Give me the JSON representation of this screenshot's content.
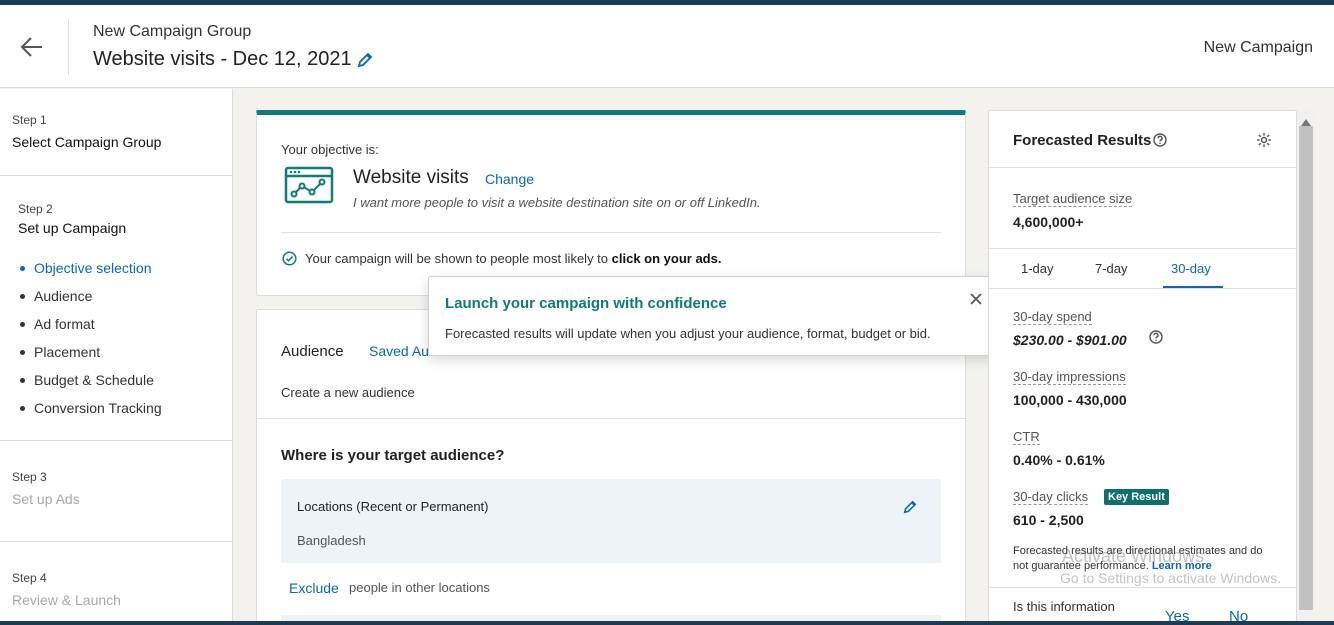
{
  "header": {
    "subtitle": "New Campaign Group",
    "title": "Website visits - Dec 12, 2021",
    "right_label": "New Campaign"
  },
  "sidebar": {
    "steps": [
      {
        "num": "Step 1",
        "title": "Select Campaign Group"
      },
      {
        "num": "Step 2",
        "title": "Set up Campaign"
      },
      {
        "num": "Step 3",
        "title": "Set up Ads"
      },
      {
        "num": "Step 4",
        "title": "Review & Launch"
      }
    ],
    "substeps": [
      {
        "label": "Objective selection"
      },
      {
        "label": "Audience"
      },
      {
        "label": "Ad format"
      },
      {
        "label": "Placement"
      },
      {
        "label": "Budget & Schedule"
      },
      {
        "label": "Conversion Tracking"
      }
    ]
  },
  "objective": {
    "label": "Your objective is:",
    "name": "Website visits",
    "change": "Change",
    "description": "I want more people to visit a website destination site on or off LinkedIn.",
    "note_prefix": "Your campaign will be shown to people most likely to ",
    "note_bold": "click on your ads."
  },
  "audience": {
    "title": "Audience",
    "saved": "Saved Au",
    "create": "Create a new audience",
    "where": "Where is your target audience?",
    "locations_title": "Locations (Recent or Permanent)",
    "locations_value": "Bangladesh",
    "exclude": "Exclude",
    "exclude_text": "people in other locations"
  },
  "popover": {
    "title": "Launch your campaign with confidence",
    "text": "Forecasted results will update when you adjust your audience, format, budget or bid."
  },
  "forecast": {
    "title": "Forecasted Results",
    "audience_label": "Target audience size",
    "audience_value": "4,600,000+",
    "tabs": [
      "1-day",
      "7-day",
      "30-day"
    ],
    "active_tab": "30-day",
    "spend_label": "30-day spend",
    "spend_value": "$230.00 - $901.00",
    "impressions_label": "30-day impressions",
    "impressions_value": "100,000 - 430,000",
    "ctr_label": "CTR",
    "ctr_value": "0.40% - 0.61%",
    "clicks_label": "30-day clicks",
    "clicks_badge": "Key Result",
    "clicks_value": "610 - 2,500",
    "disclaimer": "Forecasted results are directional estimates and do not guarantee performance.",
    "learn_more": "Learn more",
    "question": "Is this information",
    "yes": "Yes",
    "no": "No"
  },
  "watermark": {
    "line1": "Activate Windows",
    "line2": "Go to Settings to activate Windows."
  },
  "colors": {
    "accent": "#0a66c2",
    "teal": "#0f7b7b",
    "badge": "#0f6e6e"
  }
}
